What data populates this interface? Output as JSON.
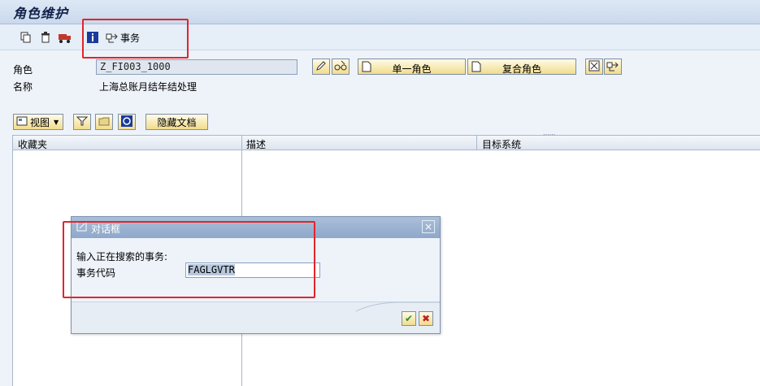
{
  "title": "角色维护",
  "toolbar": {
    "transaction_label": "事务"
  },
  "form": {
    "role_label": "角色",
    "role_value": "Z_FI003_1000",
    "name_label": "名称",
    "name_value": "上海总账月结年结处理",
    "single_role_label": "单一角色",
    "composite_role_label": "复合角色"
  },
  "tools": {
    "view_label": "视图",
    "hide_doc_label": "隐藏文档"
  },
  "grid": {
    "columns": [
      "收藏夹",
      "描述",
      "目标系统"
    ]
  },
  "dialog": {
    "title": "对话框",
    "prompt": "输入正在搜索的事务:",
    "code_label": "事务代码",
    "code_value": "FAGLGVTR"
  }
}
